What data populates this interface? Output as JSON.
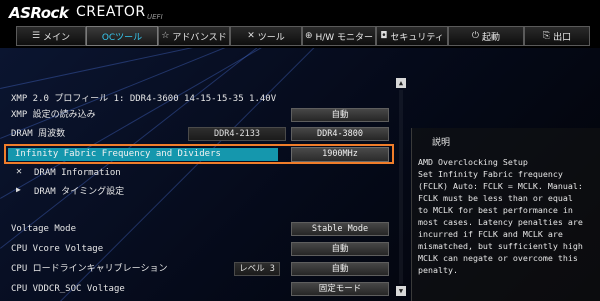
{
  "header": {
    "brand": "ASRock",
    "product": "CREATOR",
    "edition": "UEFI"
  },
  "nav": {
    "tabs": [
      {
        "label": "メイン",
        "icon": "list-icon",
        "active": false
      },
      {
        "label": "OCツール",
        "icon": "",
        "active": true
      },
      {
        "label": "アドバンスド",
        "icon": "star-icon",
        "active": false
      },
      {
        "label": "ツール",
        "icon": "tools-icon",
        "active": false
      },
      {
        "label": "H/W モニター",
        "icon": "globe-icon",
        "active": false
      },
      {
        "label": "セキュリティ",
        "icon": "shield-icon",
        "active": false
      },
      {
        "label": "起動",
        "icon": "power-icon",
        "active": false
      },
      {
        "label": "出口",
        "icon": "exit-icon",
        "active": false
      }
    ]
  },
  "settings": {
    "xmp_profile": "XMP 2.0 プロフィール 1: DDR4-3600 14-15-15-35 1.40V",
    "load_xmp": {
      "label": "XMP 設定の読み込み",
      "value": "自動"
    },
    "dram_freq": {
      "label": "DRAM 周波数",
      "current": "DDR4-2133",
      "value": "DDR4-3800"
    },
    "fclk": {
      "label": "Infinity Fabric Frequency and Dividers",
      "value": "1900MHz"
    },
    "dram_info": {
      "label": "DRAM Information"
    },
    "dram_timing": {
      "label": "DRAM タイミング設定"
    },
    "voltage_mode": {
      "label": "Voltage Mode",
      "value": "Stable Mode"
    },
    "vcore": {
      "label": "CPU Vcore Voltage",
      "value": "自動"
    },
    "llc": {
      "label": "CPU ロードラインキャリブレーション",
      "current": "レベル 3",
      "value": "自動"
    },
    "vddcr_soc": {
      "label": "CPU VDDCR_SOC Voltage",
      "value": "固定モード"
    }
  },
  "description": {
    "title": "説明",
    "body": "AMD Overclocking Setup\nSet Infinity Fabric frequency\n(FCLK) Auto: FCLK = MCLK. Manual:\nFCLK must be less than or equal\nto MCLK for best performance in\nmost cases. Latency penalties are\nincurred if FCLK and MCLK are\nmismatched, but sufficiently high\nMCLK can negate or overcome this\npenalty."
  },
  "colors": {
    "accent": "#37c8f0",
    "highlight_bar": "#1597ad",
    "highlight_border": "#f07d2a"
  }
}
